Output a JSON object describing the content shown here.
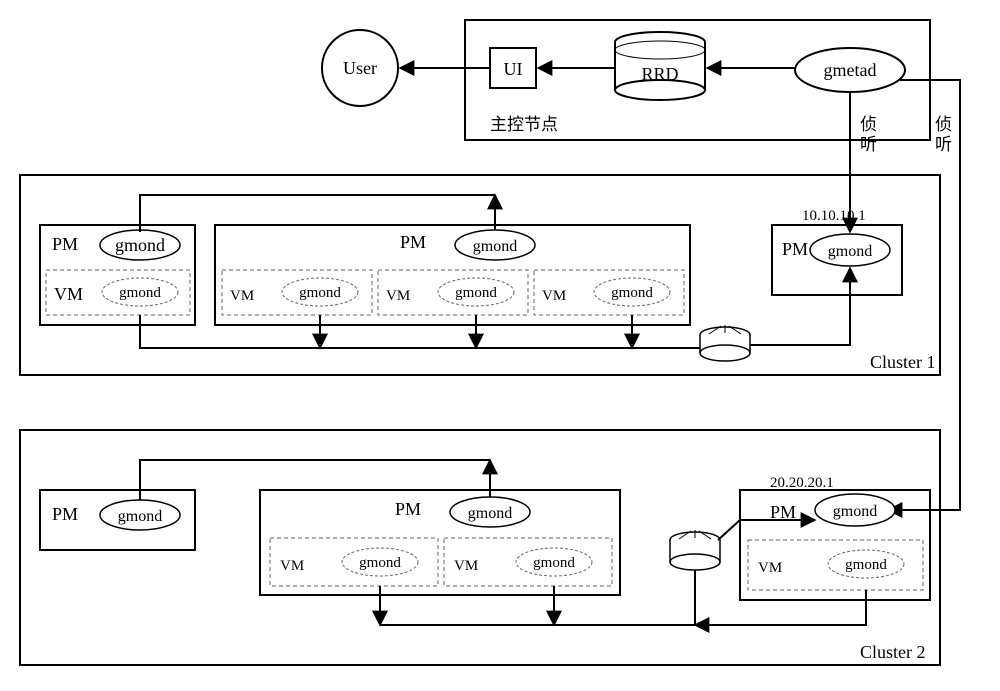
{
  "top": {
    "user": "User",
    "ui": "UI",
    "rrd": "RRD",
    "gmetad": "gmetad",
    "master_node": "主控节点",
    "listen1": "侦听",
    "listen2": "侦听"
  },
  "cluster1": {
    "title": "Cluster 1",
    "ip": "10.10.10.1",
    "pm1": {
      "pm": "PM",
      "gmond": "gmond",
      "vm": "VM",
      "vm_gmond": "gmond"
    },
    "pm2": {
      "pm": "PM",
      "gmond": "gmond",
      "vm1": "VM",
      "vm1_gmond": "gmond",
      "vm2": "VM",
      "vm2_gmond": "gmond",
      "vm3": "VM",
      "vm3_gmond": "gmond"
    },
    "pm3": {
      "pm": "PM",
      "gmond": "gmond"
    }
  },
  "cluster2": {
    "title": "Cluster 2",
    "ip": "20.20.20.1",
    "pm1": {
      "pm": "PM",
      "gmond": "gmond"
    },
    "pm2": {
      "pm": "PM",
      "gmond": "gmond",
      "vm1": "VM",
      "vm1_gmond": "gmond",
      "vm2": "VM",
      "vm2_gmond": "gmond"
    },
    "pm3": {
      "pm": "PM",
      "gmond": "gmond",
      "vm": "VM",
      "vm_gmond": "gmond"
    }
  }
}
